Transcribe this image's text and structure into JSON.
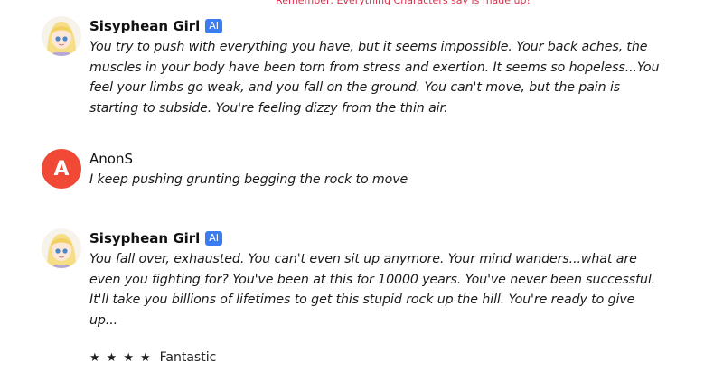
{
  "notice": "Remember: Everything Characters say is made up!",
  "messages": [
    {
      "author": "Sisyphean Girl",
      "badge": "AI",
      "text": "You try to push with everything you have, but it seems impossible. Your back aches, the muscles in your body have been torn from stress and exertion. It seems so hopeless...You feel your limbs go weak, and you fall on the ground. You can't move, but the pain is starting to subside. You're feeling dizzy from the thin air."
    },
    {
      "author": "AnonS",
      "avatar_letter": "A",
      "text": "I keep pushing grunting begging the rock to move"
    },
    {
      "author": "Sisyphean Girl",
      "badge": "AI",
      "text": "You fall over, exhausted. You can't even sit up anymore. Your mind wanders...what are even you fighting for? You've been at this for 10000 years. You've never been successful. It'll take you billions of lifetimes to get this stupid rock up the hill. You're ready to give up...",
      "rating": {
        "stars": 4,
        "label": "Fantastic"
      }
    }
  ],
  "colors": {
    "badge": "#3b7cf0",
    "user_avatar": "#f04a37",
    "notice": "#d9304a"
  }
}
